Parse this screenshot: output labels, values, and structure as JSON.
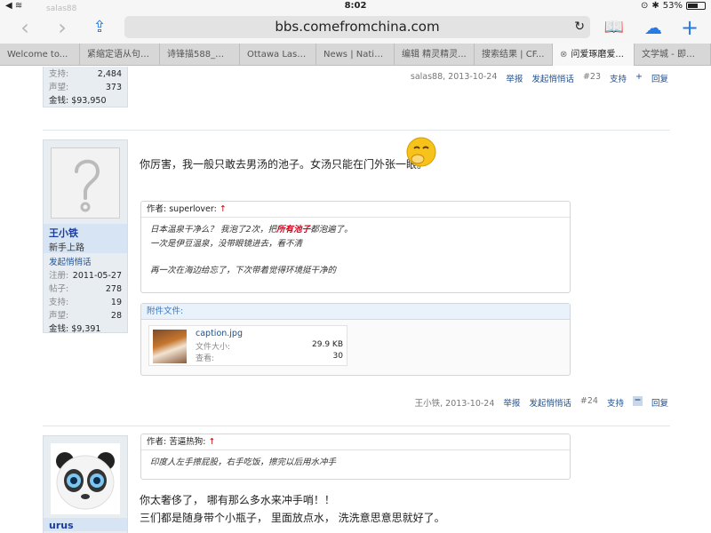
{
  "status": {
    "time": "8:02",
    "battery": "53%",
    "battery_level": 0.53
  },
  "toolbar": {
    "ghost_user": "salas88",
    "url": "bbs.comefromchina.com",
    "icons": [
      "back-icon",
      "forward-icon",
      "share-icon",
      "reload-icon",
      "bookmarks-icon",
      "cloud-tabs-icon",
      "new-tab-icon"
    ]
  },
  "tabs": [
    {
      "label": "Welcome to..."
    },
    {
      "label": "紧缩定语从句“..."
    },
    {
      "label": "诗锋描588_文..."
    },
    {
      "label": "Ottawa Laser..."
    },
    {
      "label": "News | Natio..."
    },
    {
      "label": "编辑 精灵精灵..."
    },
    {
      "label": "搜索结果 | CF..."
    },
    {
      "label": "问爱琢磨爱..."
    },
    {
      "label": "文学城 - 即时..."
    }
  ],
  "post23": {
    "stats": [
      {
        "k": "支持:",
        "v": "2,484"
      },
      {
        "k": "声望:",
        "v": "373"
      }
    ],
    "money": "金钱: $93,950",
    "meta": {
      "author_date": "salas88, 2013-10-24",
      "report": "举报",
      "pm": "发起悄悄话",
      "num": "#23",
      "support": "支持",
      "plus": "+",
      "reply": "回复"
    }
  },
  "post24": {
    "username": "王小铁",
    "rank": "新手上路",
    "pm_link": "发起悄悄话",
    "stats": [
      {
        "k": "注册:",
        "v": "2011-05-27"
      },
      {
        "k": "帖子:",
        "v": "278"
      },
      {
        "k": "支持:",
        "v": "19"
      },
      {
        "k": "声望:",
        "v": "28"
      }
    ],
    "money": "金钱: $9,391",
    "text": "你厉害，我一般只敢去男汤的池子。女汤只能在门外张一眼。",
    "quote": {
      "head_prefix": "作者: ",
      "author": "superlover:",
      "arrow": "↑",
      "line1_a": "日本温泉干净么？ 我泡了2次，把",
      "line1_red": "所有池子",
      "line1_b": "都泡遍了。",
      "line2": "一次是伊豆温泉，没带眼镜进去，看不清",
      "line3": "再一次在海边给忘了，下次带着觉得环境挺干净的"
    },
    "attachment": {
      "head": "附件文件:",
      "filename": "caption.jpg",
      "size_label": "文件大小:",
      "size": "29.9 KB",
      "views_label": "查看:",
      "views": "30"
    },
    "meta": {
      "author_date": "王小铁, 2013-10-24",
      "report": "举报",
      "pm": "发起悄悄话",
      "num": "#24",
      "support": "支持",
      "minus": "−",
      "reply": "回复"
    }
  },
  "post25": {
    "username": "urus",
    "quote": {
      "head_prefix": "作者: ",
      "author": "苦逼热狗:",
      "arrow": "↑",
      "line1": "印度人左手擦屁股，右手吃饭，擦完以后用水冲手"
    },
    "text1": "你太奢侈了， 哪有那么多水来冲手哨！！",
    "text2": "三们都是随身带个小瓶子， 里面放点水， 洗洗意思意思就好了。"
  }
}
